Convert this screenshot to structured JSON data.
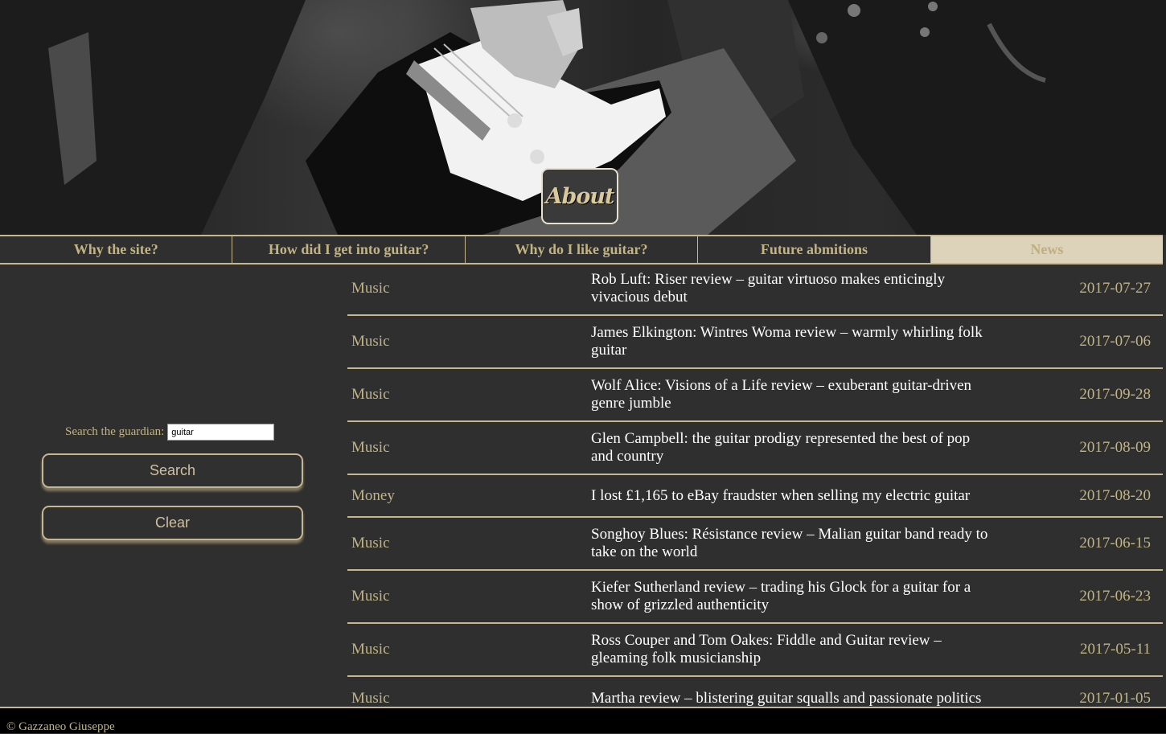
{
  "hero": {
    "badge_label": "About"
  },
  "nav": {
    "items": [
      {
        "label": "Why the site?"
      },
      {
        "label": "How did I get into guitar?"
      },
      {
        "label": "Why do I like guitar?"
      },
      {
        "label": "Future abmitions"
      },
      {
        "label": "News"
      }
    ],
    "active_index": 4
  },
  "search": {
    "label": "Search the guardian:",
    "value": "guitar",
    "search_button": "Search",
    "clear_button": "Clear"
  },
  "results": [
    {
      "section": "Music",
      "title": "Rob Luft: Riser review – guitar virtuoso makes enticingly vivacious debut",
      "date": "2017-07-27"
    },
    {
      "section": "Music",
      "title": "James Elkington: Wintres Woma review – warmly whirling folk guitar",
      "date": "2017-07-06"
    },
    {
      "section": "Music",
      "title": "Wolf Alice: Visions of a Life review – exuberant guitar-driven genre jumble",
      "date": "2017-09-28"
    },
    {
      "section": "Music",
      "title": "Glen Campbell: the guitar prodigy represented the best of pop and country",
      "date": "2017-08-09"
    },
    {
      "section": "Money",
      "title": "I lost £1,165 to eBay fraudster when selling my electric guitar",
      "date": "2017-08-20"
    },
    {
      "section": "Music",
      "title": "Songhoy Blues: Résistance review – Malian guitar band ready to take on the world",
      "date": "2017-06-15"
    },
    {
      "section": "Music",
      "title": "Kiefer Sutherland review – trading his Glock for a guitar for a show of grizzled authenticity",
      "date": "2017-06-23"
    },
    {
      "section": "Music",
      "title": "Ross Couper and Tom Oakes: Fiddle and Guitar review – gleaming folk musicianship",
      "date": "2017-05-11"
    },
    {
      "section": "Music",
      "title": "Martha review – blistering guitar squalls and passionate politics",
      "date": "2017-01-05"
    }
  ],
  "footer": {
    "text": "© Gazzaneo Giuseppe"
  },
  "colors": {
    "accent": "#c6b78f",
    "background": "#2f2f2f",
    "nav_active": "#ddd2ba"
  }
}
